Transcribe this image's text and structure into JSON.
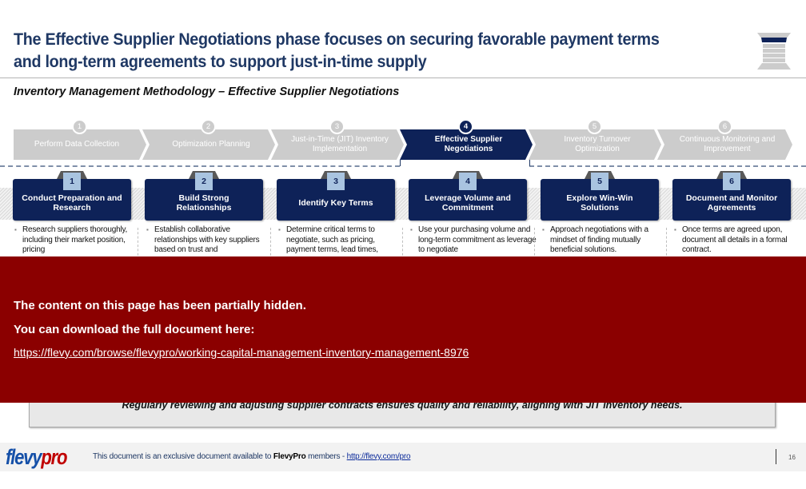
{
  "header": {
    "title": "The Effective Supplier Negotiations phase focuses on securing favorable payment terms and long-term agreements to support just-in-time supply",
    "subtitle": "Inventory Management Methodology – Effective Supplier Negotiations",
    "logo_icon": "hourglass-stack-icon"
  },
  "phases": [
    {
      "num": "1",
      "label": "Perform Data Collection",
      "active": false
    },
    {
      "num": "2",
      "label": "Optimization Planning",
      "active": false
    },
    {
      "num": "3",
      "label": "Just-in-Time (JIT) Inventory Implementation",
      "active": false
    },
    {
      "num": "4",
      "label": "Effective Supplier Negotiations",
      "active": true
    },
    {
      "num": "5",
      "label": "Inventory Turnover Optimization",
      "active": false
    },
    {
      "num": "6",
      "label": "Continuous Monitoring and Improvement",
      "active": false
    }
  ],
  "steps": [
    {
      "num": "1",
      "title": "Conduct Preparation and Research",
      "desc": "Research suppliers thoroughly, including their market position, pricing"
    },
    {
      "num": "2",
      "title": "Build Strong Relationships",
      "desc": "Establish collaborative relationships with key suppliers based on trust and"
    },
    {
      "num": "3",
      "title": "Identify Key Terms",
      "desc": "Determine critical terms to negotiate, such as pricing, payment terms, lead times,"
    },
    {
      "num": "4",
      "title": "Leverage Volume and Commitment",
      "desc": "Use your purchasing volume and long-term commitment as leverage to negotiate"
    },
    {
      "num": "5",
      "title": "Explore Win-Win Solutions",
      "desc": "Approach negotiations with a mindset of finding mutually beneficial solutions."
    },
    {
      "num": "6",
      "title": "Document and Monitor Agreements",
      "desc": "Once terms are agreed upon, document all details in a formal contract."
    }
  ],
  "summary": "Regularly reviewing and adjusting supplier contracts ensures quality and reliability, aligning with JIT inventory needs.",
  "overlay": {
    "line1": "The content on this page has been partially hidden.",
    "line2": "You can download the full document here:",
    "link": "https://flevy.com/browse/flevypro/working-capital-management-inventory-management-8976"
  },
  "footer": {
    "logo_part1": "flevy",
    "logo_part2": "pro",
    "text_prefix": "This document is an exclusive document available to ",
    "text_brand": "FlevyPro",
    "text_suffix": " members - ",
    "link": "http://flevy.com/pro",
    "page_number": "16"
  },
  "colors": {
    "navy": "#0e2258",
    "title_blue": "#1f3864",
    "inactive_gray": "#cccccc",
    "overlay_red": "#8b0000",
    "step_num_bg": "#a9c4e0"
  }
}
